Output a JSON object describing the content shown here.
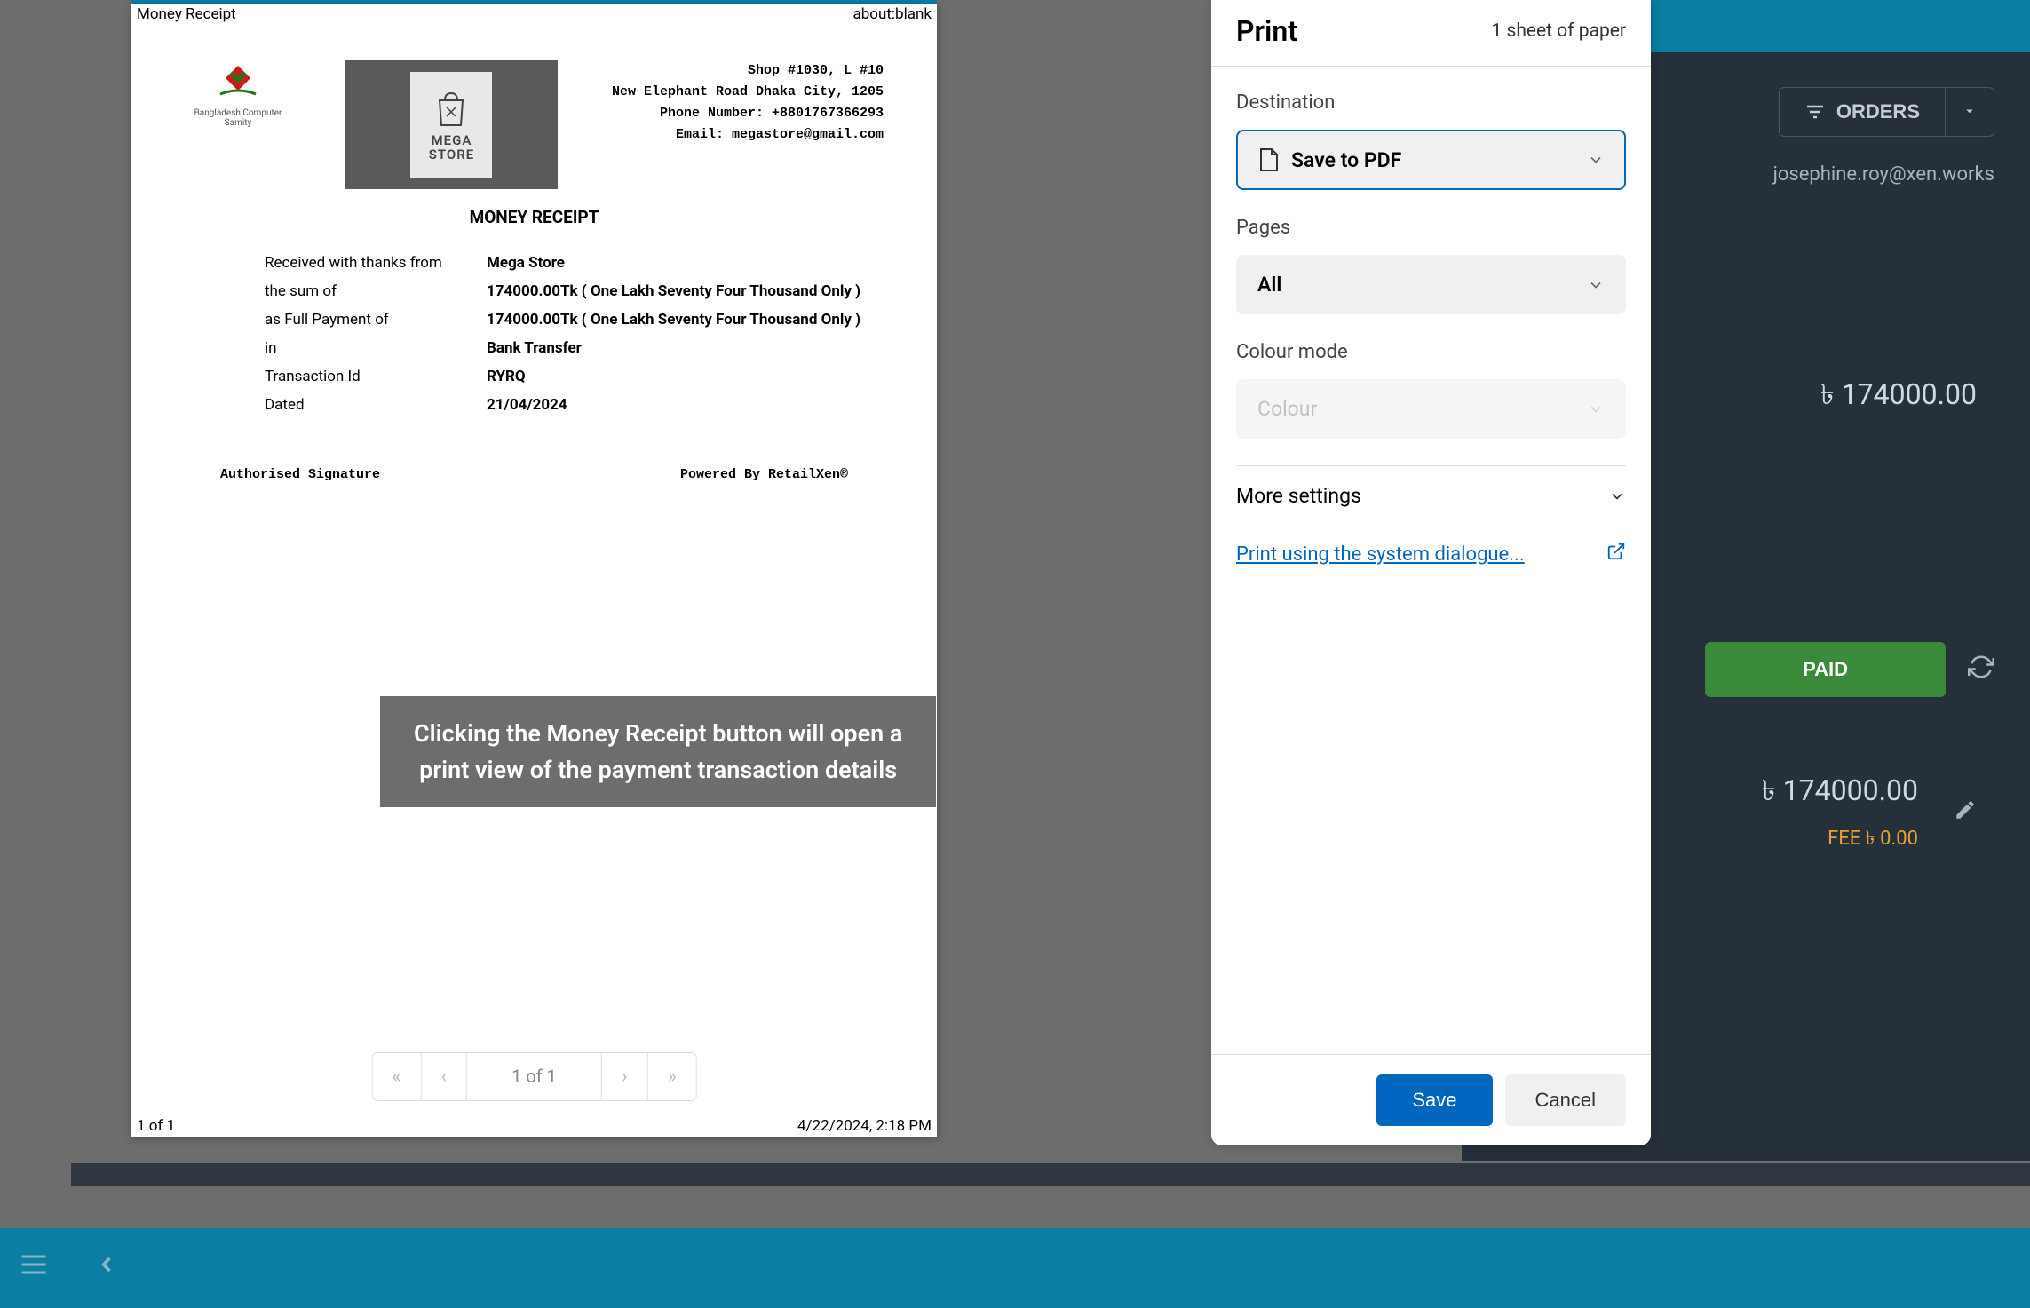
{
  "background": {
    "orders_button": "ORDERS",
    "email": "josephine.roy@xen.works",
    "amount": "৳ 174000.00",
    "paid_button": "PAID",
    "fee_amount": "৳ 174000.00",
    "fee_label": "FEE ৳ 0.00"
  },
  "preview": {
    "header_left": "Money Receipt",
    "header_right": "about:blank",
    "footer_left": "1 of 1",
    "footer_right": "4/22/2024, 2:18 PM",
    "logo_left_caption": "Bangladesh Computer Samity",
    "mega": "MEGA",
    "store": "STORE",
    "store_shop": "Shop #1030, L #10",
    "store_addr": "New Elephant Road Dhaka City, 1205",
    "store_phone": "Phone Number: +8801767366293",
    "store_email": "Email: megastore@gmail.com",
    "title": "MONEY RECEIPT",
    "rows": [
      {
        "label": "Received with thanks from",
        "value": "Mega Store"
      },
      {
        "label": "the sum of",
        "value": "174000.00Tk ( One Lakh Seventy Four Thousand Only )"
      },
      {
        "label": "as Full Payment of",
        "value": "174000.00Tk ( One Lakh Seventy Four Thousand Only )"
      },
      {
        "label": "in",
        "value": "Bank Transfer"
      },
      {
        "label": "Transaction Id",
        "value": "RYRQ"
      },
      {
        "label": "Dated",
        "value": "21/04/2024"
      }
    ],
    "sig_left": "Authorised Signature",
    "sig_right": "Powered By RetailXen®",
    "pager_text": "1 of 1"
  },
  "callout": {
    "line1": "Clicking the Money Receipt button will open a",
    "line2": "print view of the payment transaction details"
  },
  "dialog": {
    "title": "Print",
    "sheets": "1 sheet of paper",
    "destination_label": "Destination",
    "destination_value": "Save to PDF",
    "pages_label": "Pages",
    "pages_value": "All",
    "colour_label": "Colour mode",
    "colour_value": "Colour",
    "more_settings": "More settings",
    "system_link": "Print using the system dialogue...",
    "save": "Save",
    "cancel": "Cancel"
  }
}
